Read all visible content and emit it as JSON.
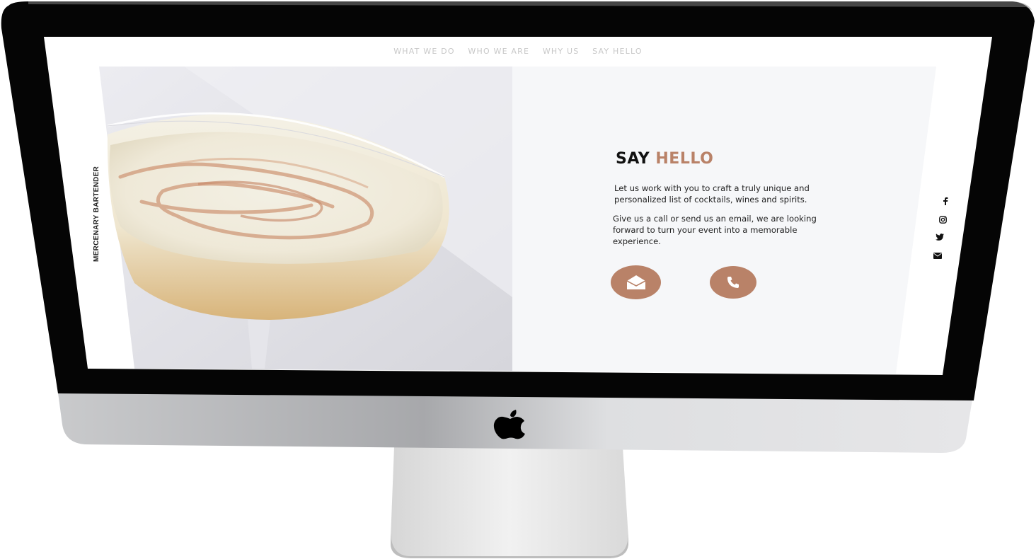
{
  "nav": {
    "items": [
      "WHAT WE DO",
      "WHO WE ARE",
      "WHY US",
      "SAY HELLO"
    ]
  },
  "brand": "MERCENARY BARTENDER",
  "contact": {
    "title_part1": "SAY",
    "title_part2": "HELLO",
    "paragraph1_line1": "Let us work with you to craft a truly unique and",
    "paragraph1_line2": "personalized list of cocktails, wines and spirits.",
    "paragraph2_line1": "Give us a call or send us an email, we are looking",
    "paragraph2_line2": "forward to turn your event into a memorable",
    "paragraph2_line3": "experience."
  },
  "social_icons": [
    "facebook-icon",
    "instagram-icon",
    "twitter-icon",
    "envelope-icon"
  ],
  "colors": {
    "accent": "#b98268",
    "nav_text": "#c8c8c8",
    "panel_bg": "#f6f7f9",
    "bezel": "#050505"
  }
}
